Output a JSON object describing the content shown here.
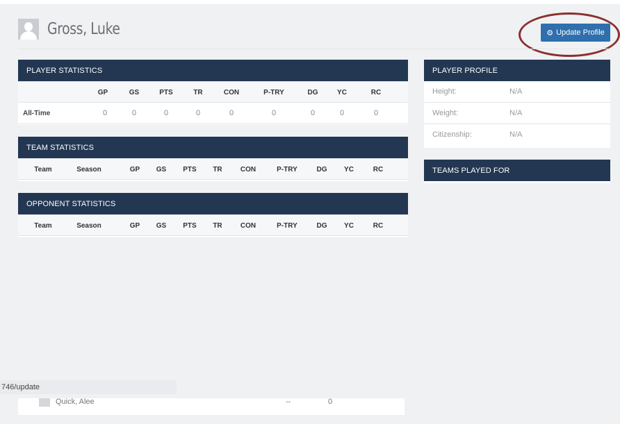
{
  "header": {
    "player_name": "Gross, Luke",
    "update_button_label": "Update Profile"
  },
  "player_statistics": {
    "title": "PLAYER STATISTICS",
    "columns": [
      "GP",
      "GS",
      "PTS",
      "TR",
      "CON",
      "P-TRY",
      "DG",
      "YC",
      "RC"
    ],
    "rows": [
      {
        "label": "All-Time",
        "values": [
          "0",
          "0",
          "0",
          "0",
          "0",
          "0",
          "0",
          "0",
          "0"
        ]
      }
    ]
  },
  "team_statistics": {
    "title": "TEAM STATISTICS",
    "columns": [
      "Team",
      "Season",
      "GP",
      "GS",
      "PTS",
      "TR",
      "CON",
      "P-TRY",
      "DG",
      "YC",
      "RC"
    ]
  },
  "opponent_statistics": {
    "title": "OPPONENT STATISTICS",
    "columns": [
      "Team",
      "Season",
      "GP",
      "GS",
      "PTS",
      "TR",
      "CON",
      "P-TRY",
      "DG",
      "YC",
      "RC"
    ]
  },
  "player_profile": {
    "title": "PLAYER PROFILE",
    "rows": [
      {
        "label": "Height:",
        "value": "N/A"
      },
      {
        "label": "Weight:",
        "value": "N/A"
      },
      {
        "label": "Citizenship:",
        "value": "N/A"
      }
    ]
  },
  "teams_played_for": {
    "title": "TEAMS PLAYED FOR"
  },
  "status_bar": {
    "url_text": "746/update"
  },
  "bottom_row": {
    "name": "Quick, Alee",
    "col1": "--",
    "col2": "0"
  }
}
